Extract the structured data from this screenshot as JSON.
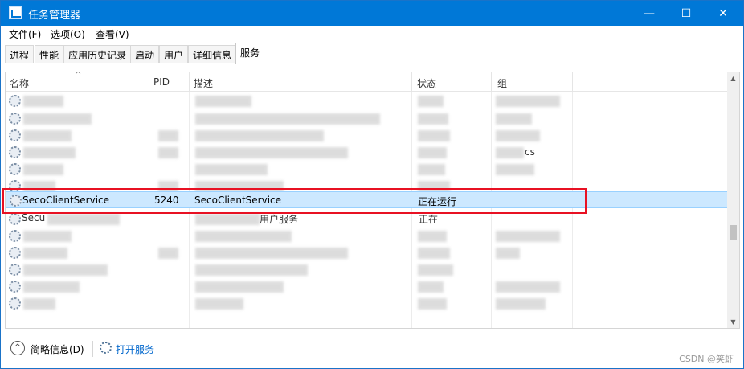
{
  "window": {
    "title": "任务管理器",
    "controls": {
      "minimize": "—",
      "maximize": "☐",
      "close": "✕"
    },
    "title_bar_color": "#0078d7"
  },
  "menu": {
    "items": [
      "文件(F)",
      "选项(O)",
      "查看(V)"
    ]
  },
  "tabs": {
    "items": [
      "进程",
      "性能",
      "应用历史记录",
      "启动",
      "用户",
      "详细信息",
      "服务"
    ],
    "active": "服务"
  },
  "table": {
    "columns": [
      "名称",
      "PID",
      "描述",
      "状态",
      "组"
    ],
    "sort_caret": "^",
    "visible_rows_above_selected": 5,
    "visible_rows_below_selected": 7,
    "selected_row": {
      "name": "SecoClientService",
      "pid": "5240",
      "description": "SecoClientService",
      "status": "正在运行",
      "group": ""
    },
    "partial_text_fragments": {
      "row_after_selected_name": "Secu",
      "row_after_selected_status": "正在",
      "row_after_selected_description": "用户服务",
      "row3_group_fragment": "cs"
    }
  },
  "highlight_color": "#e81123",
  "selection_color": "#cce8ff",
  "footer": {
    "chevron": "^",
    "brief_label": "简略信息(D)",
    "open_services_label": "打开服务",
    "watermark": "CSDN @笑虾"
  },
  "icons": [
    "app-icon",
    "gear-icon",
    "scroll-up-icon",
    "scroll-down-icon",
    "services-icon",
    "chevron-up-icon"
  ]
}
